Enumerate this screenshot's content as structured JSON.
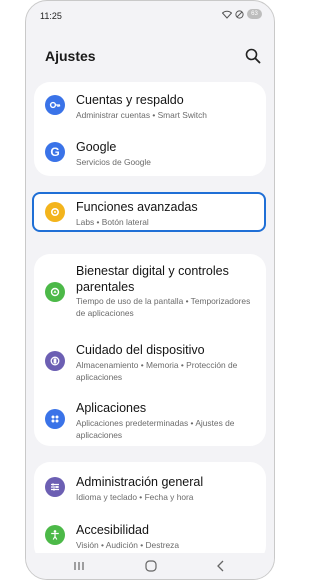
{
  "status": {
    "time": "11:25",
    "battery": "63"
  },
  "header": {
    "title": "Ajustes"
  },
  "items": {
    "cuentas": {
      "title": "Cuentas y respaldo",
      "subtitle": "Administrar cuentas  •  Smart Switch",
      "icon": "key-icon",
      "color": "#3a73e8"
    },
    "google": {
      "title": "Google",
      "subtitle": "Servicios de Google",
      "icon": "google-icon",
      "color": "#3a73e8"
    },
    "funciones": {
      "title": "Funciones avanzadas",
      "subtitle": "Labs  •  Botón lateral",
      "icon": "gear-plus-icon",
      "color": "#f3b41c"
    },
    "bienestar": {
      "title": "Bienestar digital y controles parentales",
      "subtitle": "Tiempo de uso de la pantalla  •  Temporizadores de aplicaciones",
      "icon": "wellbeing-icon",
      "color": "#4cb948"
    },
    "cuidado": {
      "title": "Cuidado del dispositivo",
      "subtitle": "Almacenamiento  •  Memoria  •  Protección de aplicaciones",
      "icon": "device-care-icon",
      "color": "#6c5fb3"
    },
    "aplicaciones": {
      "title": "Aplicaciones",
      "subtitle": "Aplicaciones predeterminadas  •  Ajustes de aplicaciones",
      "icon": "apps-icon",
      "color": "#3a73e8"
    },
    "administracion": {
      "title": "Administración general",
      "subtitle": "Idioma y teclado  •  Fecha y hora",
      "icon": "sliders-icon",
      "color": "#6c5fb3"
    },
    "accesibilidad": {
      "title": "Accesibilidad",
      "subtitle": "Visión  •  Audición  •  Destreza",
      "icon": "accessibility-icon",
      "color": "#4cb948"
    }
  }
}
